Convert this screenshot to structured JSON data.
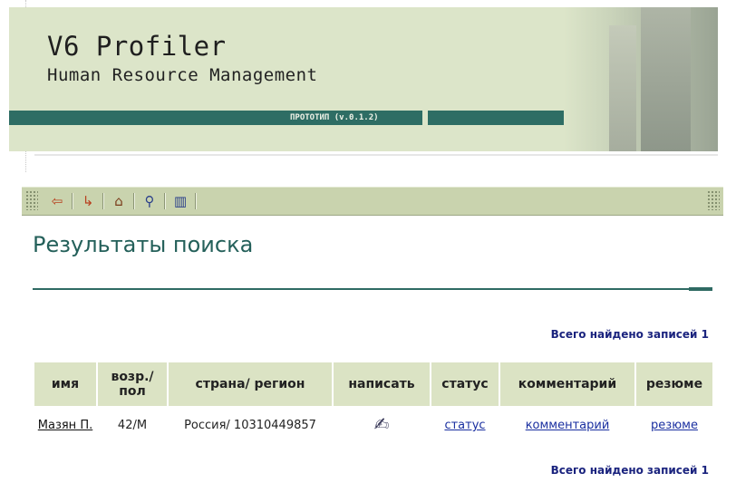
{
  "banner": {
    "title": "V6 Profiler",
    "subtitle": "Human Resource Management",
    "version_label": "ПРОТОТИП (v.0.1.2)"
  },
  "toolbar": {
    "buttons": [
      {
        "name": "back-button",
        "icon": "arrow-back-icon",
        "glyph": "⇦"
      },
      {
        "name": "return-button",
        "icon": "arrow-return-icon",
        "glyph": "↳"
      },
      {
        "name": "home-button",
        "icon": "home-icon",
        "glyph": "⌂"
      },
      {
        "name": "search-button",
        "icon": "magnifier-icon",
        "glyph": "⚲"
      },
      {
        "name": "columns-button",
        "icon": "columns-icon",
        "glyph": "▥"
      }
    ]
  },
  "page": {
    "heading": "Результаты поиска"
  },
  "results": {
    "total_top": "Всего найдено записей 1",
    "total_bottom": "Всего найдено записей 1",
    "columns": [
      "имя",
      "возр./ пол",
      "страна/ регион",
      "написать",
      "статус",
      "комментарий",
      "резюме"
    ],
    "rows": [
      {
        "name": "Мазян П.",
        "age_sex": "42/М",
        "country_region": "Россия/ 10310449857",
        "write_icon": "pencil-check-icon",
        "status": "статус",
        "comment": "комментарий",
        "resume": "резюме"
      }
    ]
  },
  "colors": {
    "banner_bg": "#dce5c9",
    "accent_teal": "#2e6d64",
    "toolbar_bg": "#c9d3ae",
    "header_row_bg": "#dbe3c4",
    "link_blue": "#1a2fa0",
    "total_text": "#1a237e"
  }
}
